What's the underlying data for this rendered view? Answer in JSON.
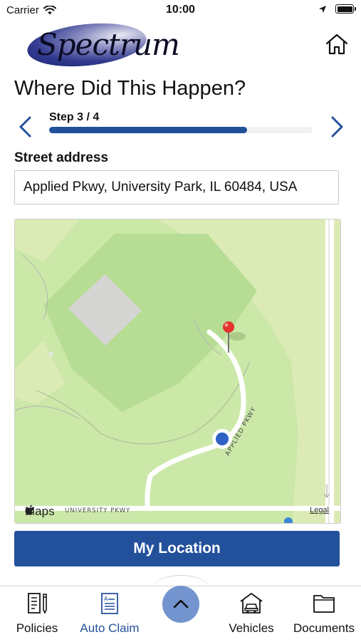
{
  "status_bar": {
    "carrier": "Carrier",
    "time": "10:00"
  },
  "header": {
    "logo_text": "Spectrum"
  },
  "page": {
    "title": "Where Did This Happen?"
  },
  "stepper": {
    "label": "Step 3 / 4",
    "current": 3,
    "total": 4,
    "progress": 0.75
  },
  "address": {
    "label": "Street address",
    "value": "Applied Pkwy, University Park, IL 60484, USA"
  },
  "map": {
    "road_labels": [
      "APPLIED PKWY",
      "UNIVERSITY PKWY"
    ],
    "attribution": "Maps",
    "legal": "Legal"
  },
  "actions": {
    "my_location": "My Location"
  },
  "tabbar": {
    "tabs": [
      {
        "label": "Policies",
        "icon": "policy-document-icon",
        "active": false
      },
      {
        "label": "Auto Claim",
        "icon": "claim-form-icon",
        "active": true
      },
      {
        "label": "Vehicles",
        "icon": "garage-car-icon",
        "active": false
      },
      {
        "label": "Documents",
        "icon": "folder-icon",
        "active": false
      }
    ],
    "center_button_icon": "chevron-up-icon"
  },
  "colors": {
    "brand": "#23509b",
    "fab": "#7394cf",
    "map_park": "#cbe8a8",
    "pin": "#e5332f",
    "location_dot": "#2d62c4"
  }
}
